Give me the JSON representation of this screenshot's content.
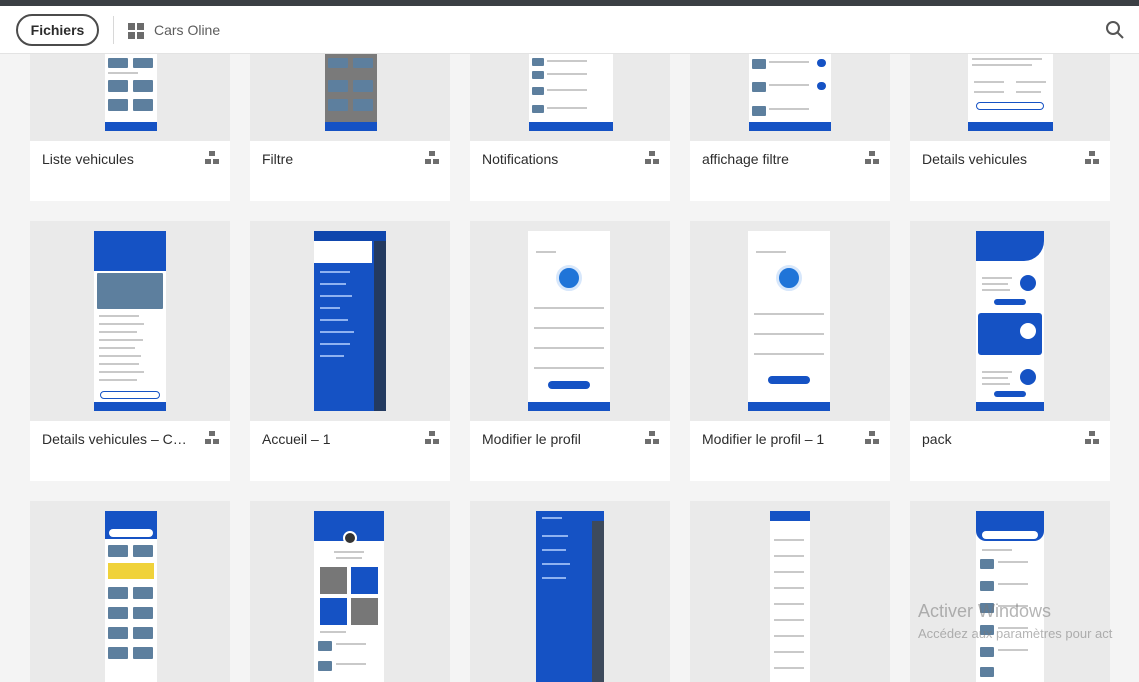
{
  "header": {
    "files_button": "Fichiers",
    "project_title": "Cars Oline"
  },
  "artboards": [
    {
      "label": "Liste vehicules"
    },
    {
      "label": "Filtre"
    },
    {
      "label": "Notifications"
    },
    {
      "label": "affichage filtre"
    },
    {
      "label": "Details vehicules"
    },
    {
      "label": "Details vehicules – Car..."
    },
    {
      "label": "Accueil – 1"
    },
    {
      "label": "Modifier le profil"
    },
    {
      "label": "Modifier le profil – 1"
    },
    {
      "label": "pack"
    }
  ],
  "watermark": {
    "title": "Activer Windows",
    "subtitle": "Accédez aux paramètres pour act"
  }
}
